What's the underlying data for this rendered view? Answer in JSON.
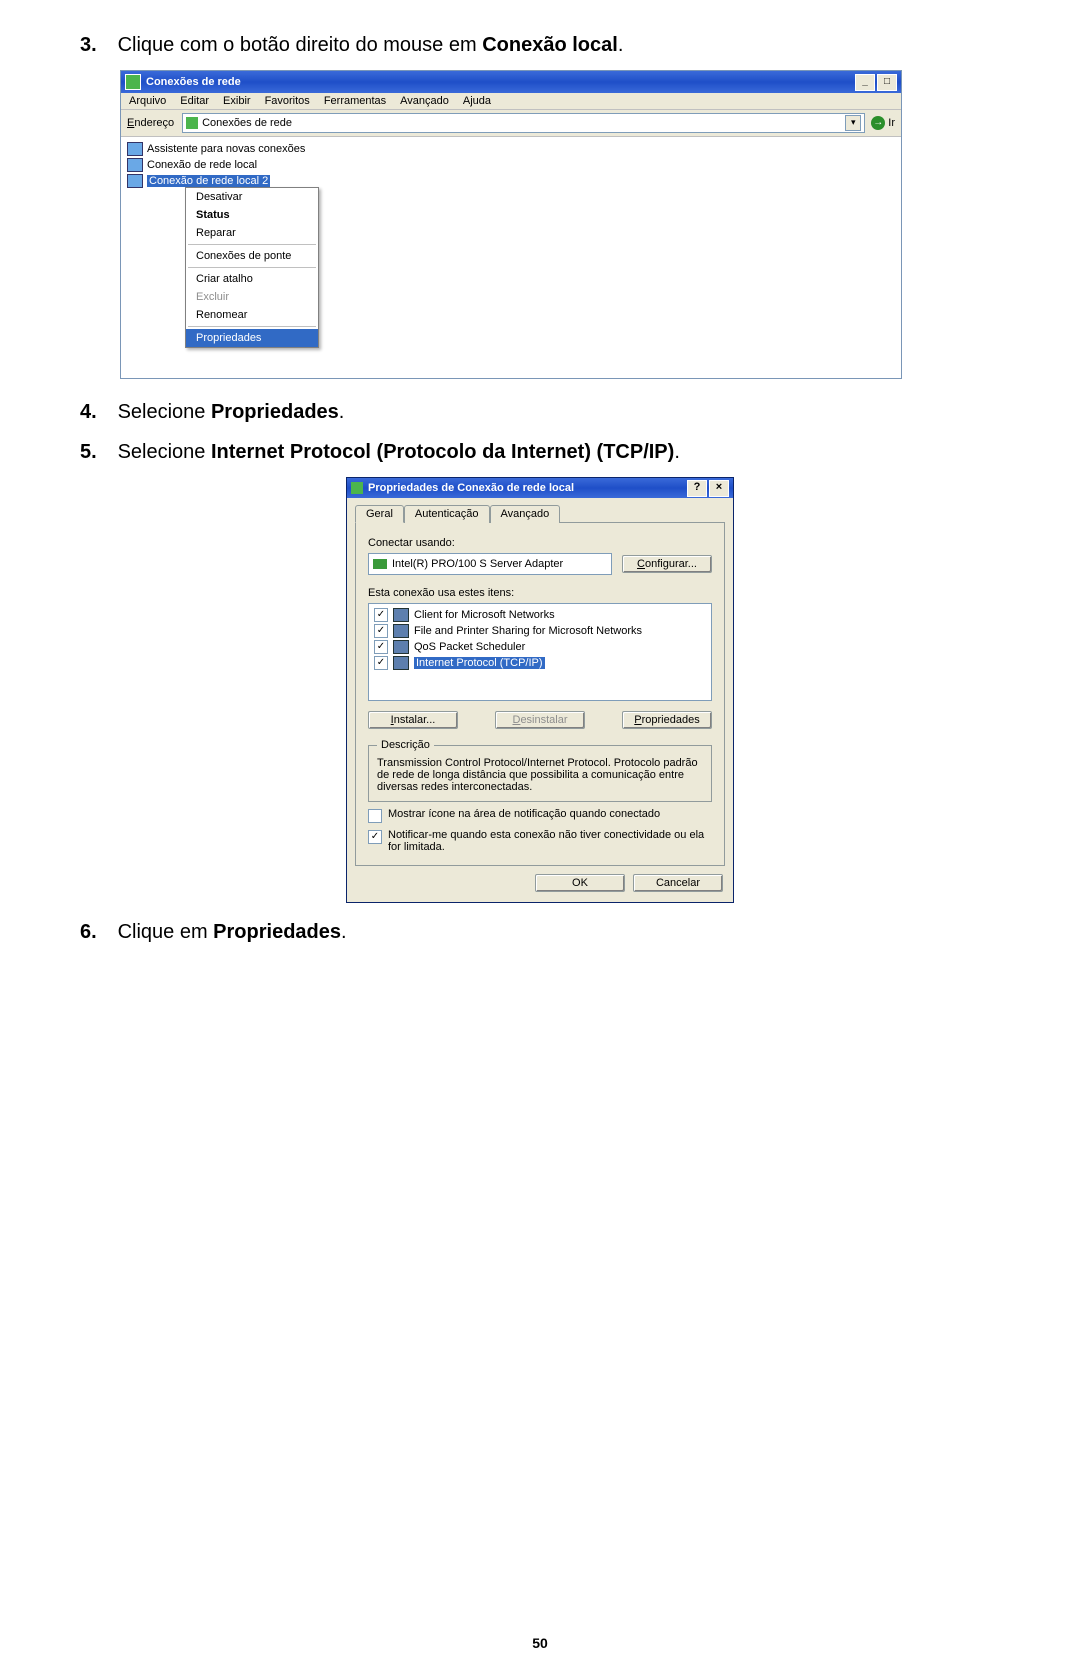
{
  "steps": {
    "s3_num": "3.",
    "s3_a": "Clique com o botão direito do mouse em ",
    "s3_b": "Conexão local",
    "s3_c": ".",
    "s4_num": "4.",
    "s4_a": "Selecione ",
    "s4_b": "Propriedades",
    "s4_c": ".",
    "s5_num": "5.",
    "s5_a": "Selecione ",
    "s5_b": "Internet Protocol (Protocolo da Internet) (TCP/IP)",
    "s5_c": ".",
    "s6_num": "6.",
    "s6_a": "Clique em ",
    "s6_b": "Propriedades",
    "s6_c": "."
  },
  "win1": {
    "title": "Conexões de rede",
    "menu": [
      "Arquivo",
      "Editar",
      "Exibir",
      "Favoritos",
      "Ferramentas",
      "Avançado",
      "Ajuda"
    ],
    "addr_label": "Endereço",
    "addr_value": "Conexões de rede",
    "go_label": "Ir",
    "items": [
      "Assistente para novas conexões",
      "Conexão de rede local",
      "Conexão de rede local 2"
    ],
    "ctx": {
      "disable": "Desativar",
      "status": "Status",
      "repair": "Reparar",
      "bridge": "Conexões de ponte",
      "shortcut": "Criar atalho",
      "delete": "Excluir",
      "rename": "Renomear",
      "props": "Propriedades"
    },
    "winbtns": {
      "min": "_",
      "max": "□",
      "close": "×"
    }
  },
  "win2": {
    "title": "Propriedades de Conexão de rede local",
    "help": "?",
    "close": "×",
    "tabs": [
      "Geral",
      "Autenticação",
      "Avançado"
    ],
    "connect_using": "Conectar usando:",
    "adapter": "Intel(R) PRO/100 S Server Adapter",
    "configure": "Configurar...",
    "items_label": "Esta conexão usa estes itens:",
    "items": [
      {
        "label": "Client for Microsoft Networks",
        "checked": true
      },
      {
        "label": "File and Printer Sharing for Microsoft Networks",
        "checked": true
      },
      {
        "label": "QoS Packet Scheduler",
        "checked": true
      },
      {
        "label": "Internet Protocol (TCP/IP)",
        "checked": true,
        "selected": true
      }
    ],
    "install": "Instalar...",
    "uninstall": "Desinstalar",
    "properties": "Propriedades",
    "desc_legend": "Descrição",
    "desc_text": "Transmission Control Protocol/Internet Protocol. Protocolo padrão de rede de longa distância que possibilita a comunicação entre diversas redes interconectadas.",
    "opt1": "Mostrar ícone na área de notificação quando conectado",
    "opt2": "Notificar-me quando esta conexão não tiver conectividade ou ela for limitada.",
    "opt1_checked": false,
    "opt2_checked": true,
    "ok": "OK",
    "cancel": "Cancelar"
  },
  "page_number": "50"
}
